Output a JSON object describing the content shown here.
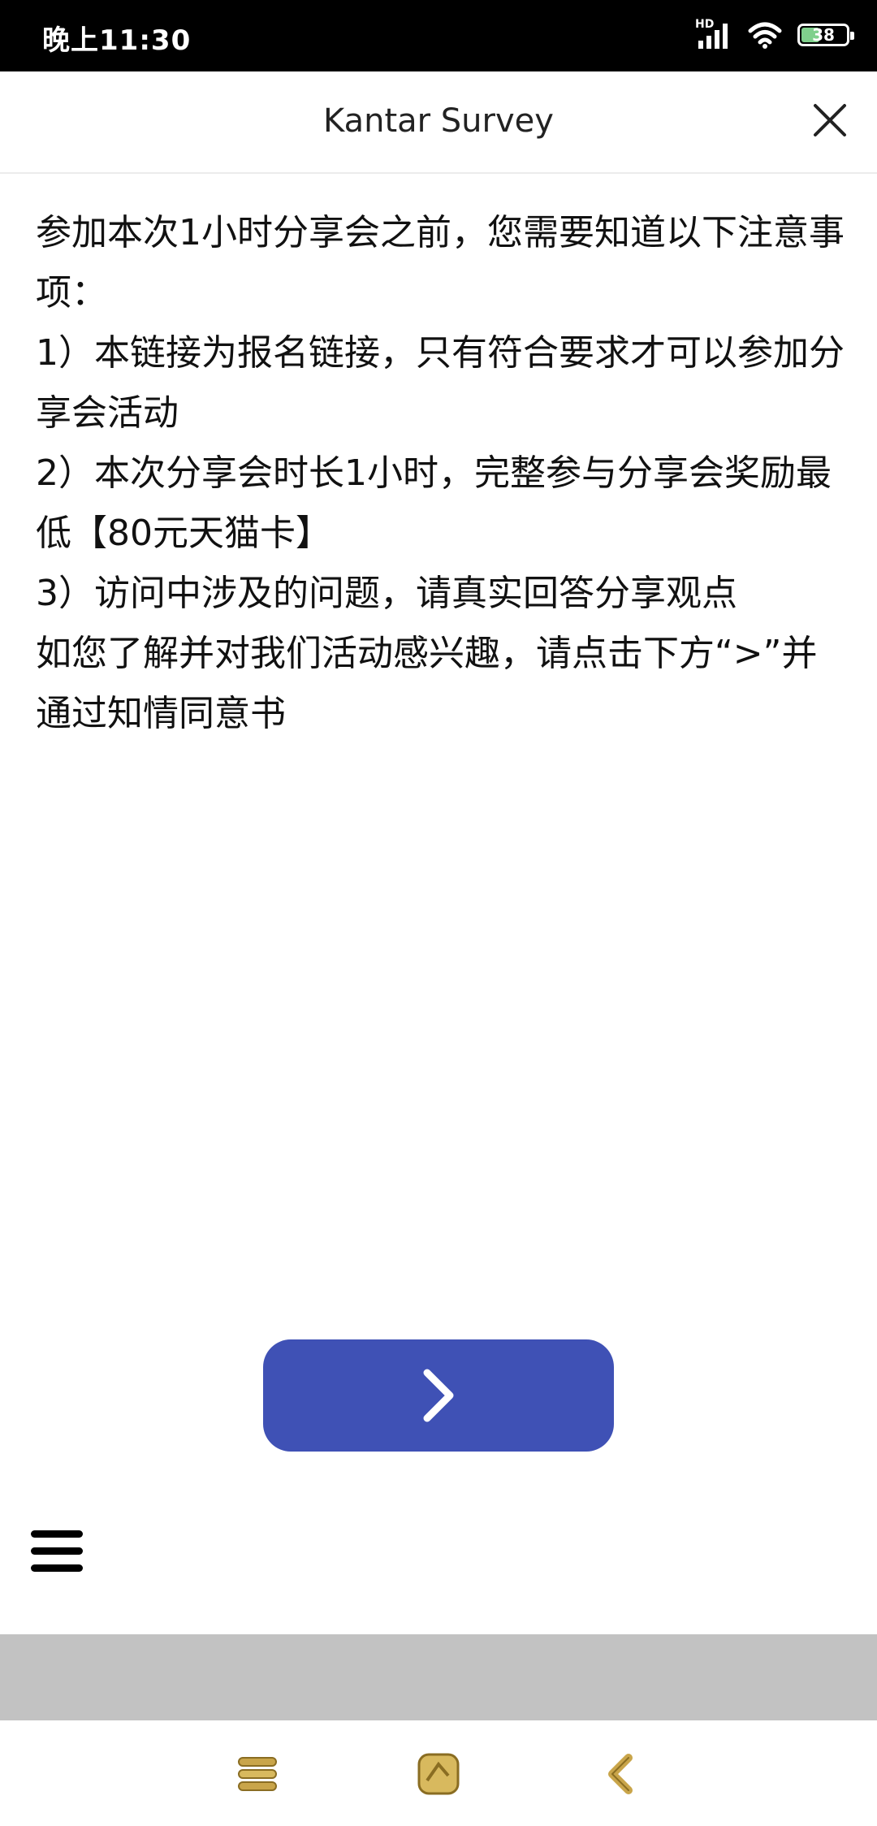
{
  "status_bar": {
    "time": "晚上11:30",
    "hd_label": "HD",
    "battery": "38",
    "icons": [
      "signal-icon",
      "wifi-icon",
      "battery-icon"
    ]
  },
  "header": {
    "title": "Kantar Survey",
    "close_icon": "close-icon"
  },
  "notice": {
    "lines": [
      "参加本次1小时分享会之前，您需要知道以下注意事项：",
      "1）本链接为报名链接，只有符合要求才可以参加分享会活动",
      "2）本次分享会时长1小时，完整参与分享会奖励最低【80元天猫卡】",
      "3）访问中涉及的问题，请真实回答分享观点",
      "如您了解并对我们活动感兴趣，请点击下方“>”并通过知情同意书"
    ]
  },
  "next_button": {
    "icon": "chevron-right-icon",
    "color": "#3f51b5"
  },
  "menu": {
    "icon": "hamburger-menu-icon"
  },
  "system_nav": {
    "keys": [
      "menu-key-icon",
      "home-key-icon",
      "back-key-icon"
    ],
    "accent": "#c9a54a"
  }
}
